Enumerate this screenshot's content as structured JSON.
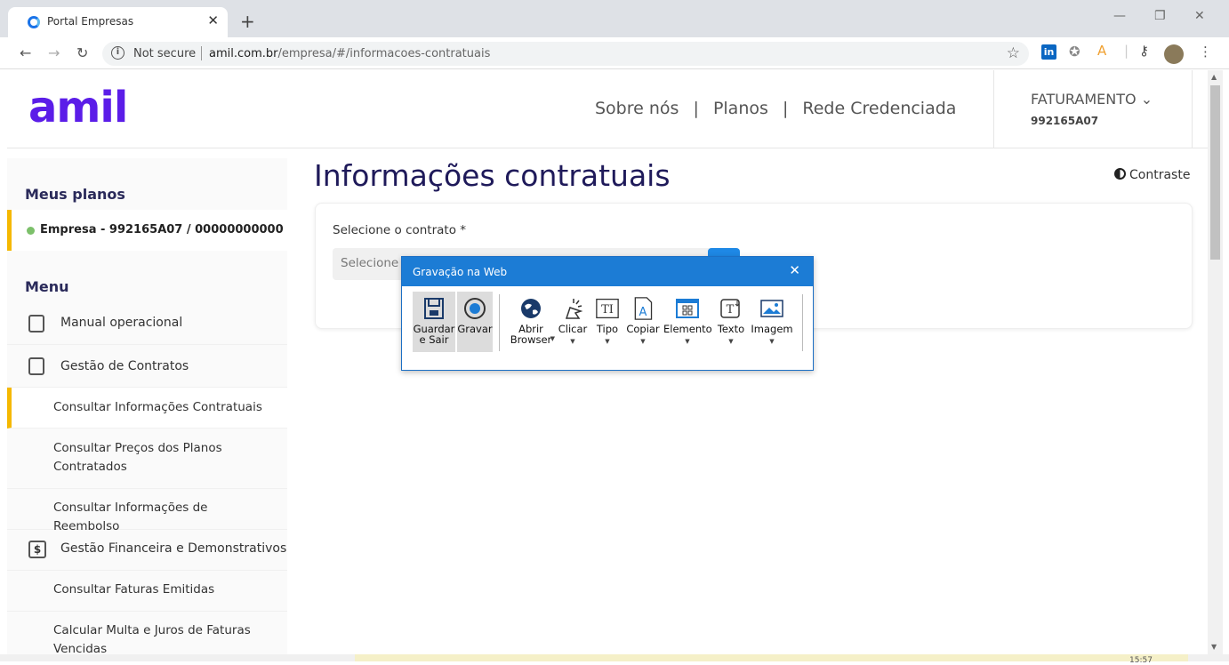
{
  "browser": {
    "tab_title": "Portal Empresas",
    "tab_close": "✕",
    "new_tab": "+",
    "not_secure": "Not secure",
    "url_domain": "amil.com.br",
    "url_path": "/empresa/#/informacoes-contratuais",
    "window_controls": [
      "—",
      "❐",
      "✕"
    ]
  },
  "header": {
    "logo": "amil",
    "nav": [
      "Sobre nós",
      "|",
      "Planos",
      "|",
      "Rede Credenciada"
    ],
    "account_name": "FATURAMENTO",
    "account_caret": "⌄",
    "account_id": "992165A07"
  },
  "sidebar": {
    "plans_heading": "Meus planos",
    "plan_item": "Empresa - 992165A07 / 00000000000",
    "menu_heading": "Menu",
    "items": [
      {
        "label": "Manual operacional",
        "type": "main"
      },
      {
        "label": "Gestão de Contratos",
        "type": "main"
      },
      {
        "label": "Consultar Informações Contratuais",
        "type": "sub",
        "active": true
      },
      {
        "label": "Consultar Preços dos Planos Contratados",
        "type": "sub"
      },
      {
        "label": "Consultar Informações de Reembolso",
        "type": "sub"
      },
      {
        "label": "Gestão Financeira e Demonstrativos",
        "type": "main"
      },
      {
        "label": "Consultar Faturas Emitidas",
        "type": "sub"
      },
      {
        "label": "Calcular Multa e Juros de Faturas Vencidas",
        "type": "sub"
      }
    ]
  },
  "main": {
    "title": "Informações contratuais",
    "contrast_label": "Contraste",
    "field_label": "Selecione o contrato *",
    "select_placeholder": "Selecione"
  },
  "popup": {
    "title": "Gravação na Web",
    "close": "✕",
    "tools": [
      {
        "label": "Guardar e Sair",
        "icon": "save-icon"
      },
      {
        "label": "Gravar",
        "icon": "record-icon"
      },
      {
        "label": "Abrir Browser",
        "icon": "globe-icon"
      },
      {
        "label": "Clicar",
        "icon": "click-icon"
      },
      {
        "label": "Tipo",
        "icon": "type-icon"
      },
      {
        "label": "Copiar",
        "icon": "copy-icon"
      },
      {
        "label": "Elemento",
        "icon": "element-icon"
      },
      {
        "label": "Texto",
        "icon": "text-icon"
      },
      {
        "label": "Imagem",
        "icon": "image-icon"
      }
    ]
  },
  "taskbar": {
    "time": "15:57"
  }
}
